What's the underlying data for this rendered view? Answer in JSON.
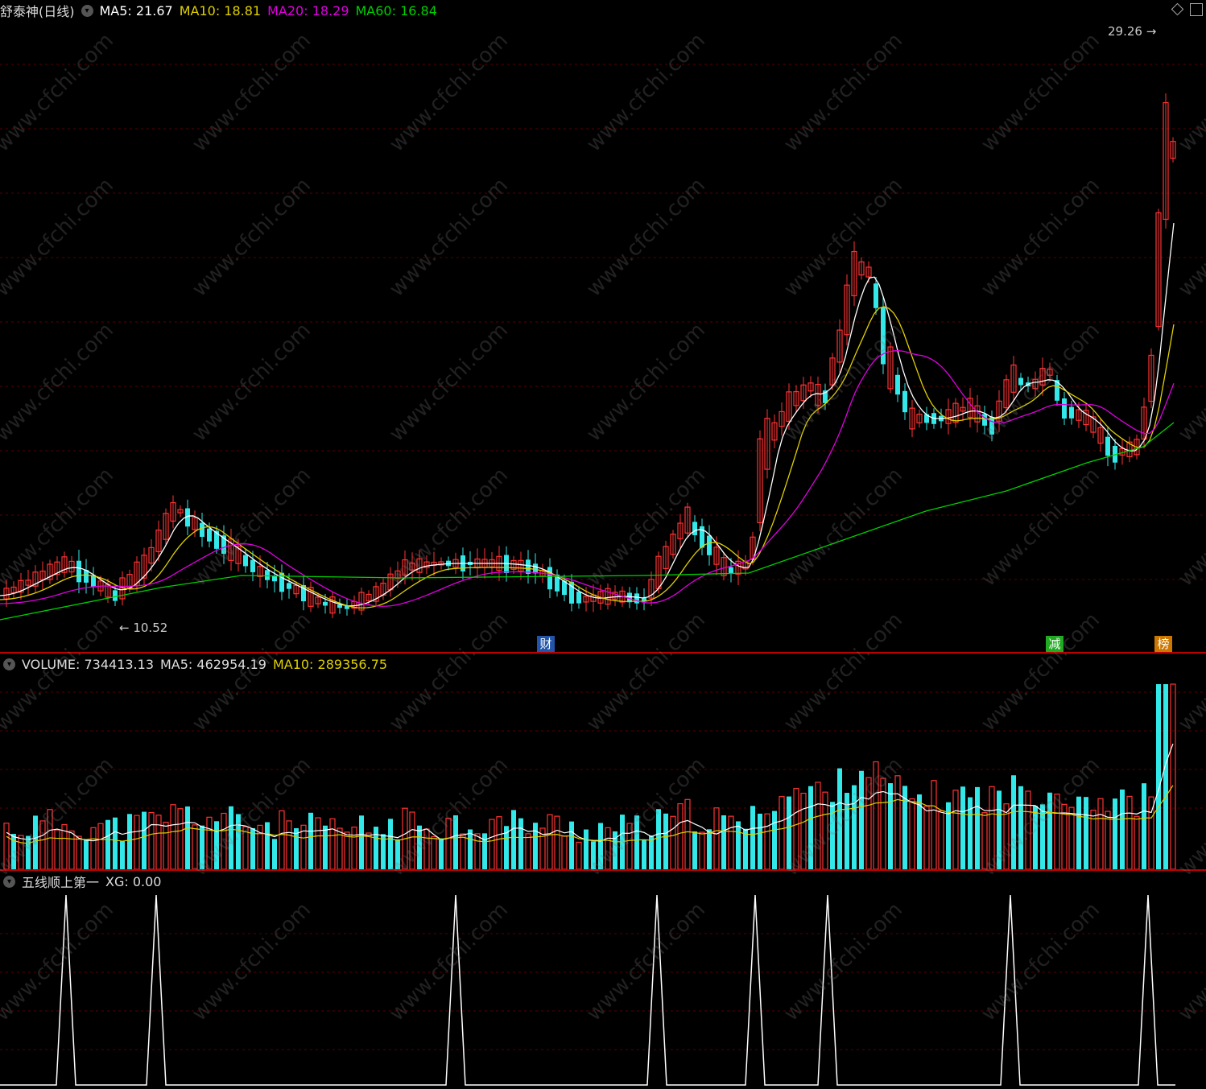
{
  "price_panel": {
    "title": "舒泰神(日线)",
    "ma5": "MA5: 21.67",
    "ma10": "MA10: 18.81",
    "ma20": "MA20: 18.29",
    "ma60": "MA60: 16.84",
    "high_label": "29.26",
    "low_label": "10.52",
    "colors": {
      "ma5": "#ffffff",
      "ma10": "#e0d000",
      "ma20": "#e000e0",
      "ma60": "#00d000",
      "up": "#ff3333",
      "down": "#33e8e8"
    }
  },
  "event_badges": [
    {
      "label": "财",
      "color": "#2255aa"
    },
    {
      "label": "减",
      "color": "#22aa22"
    },
    {
      "label": "榜",
      "color": "#cc7700"
    }
  ],
  "volume_panel": {
    "volume": "VOLUME: 734413.13",
    "ma5": "MA5: 462954.19",
    "ma10": "MA10: 289356.75"
  },
  "indicator_panel": {
    "name": "五线顺上第一",
    "xg": "XG: 0.00"
  },
  "watermark": "www.cfchi.com"
}
